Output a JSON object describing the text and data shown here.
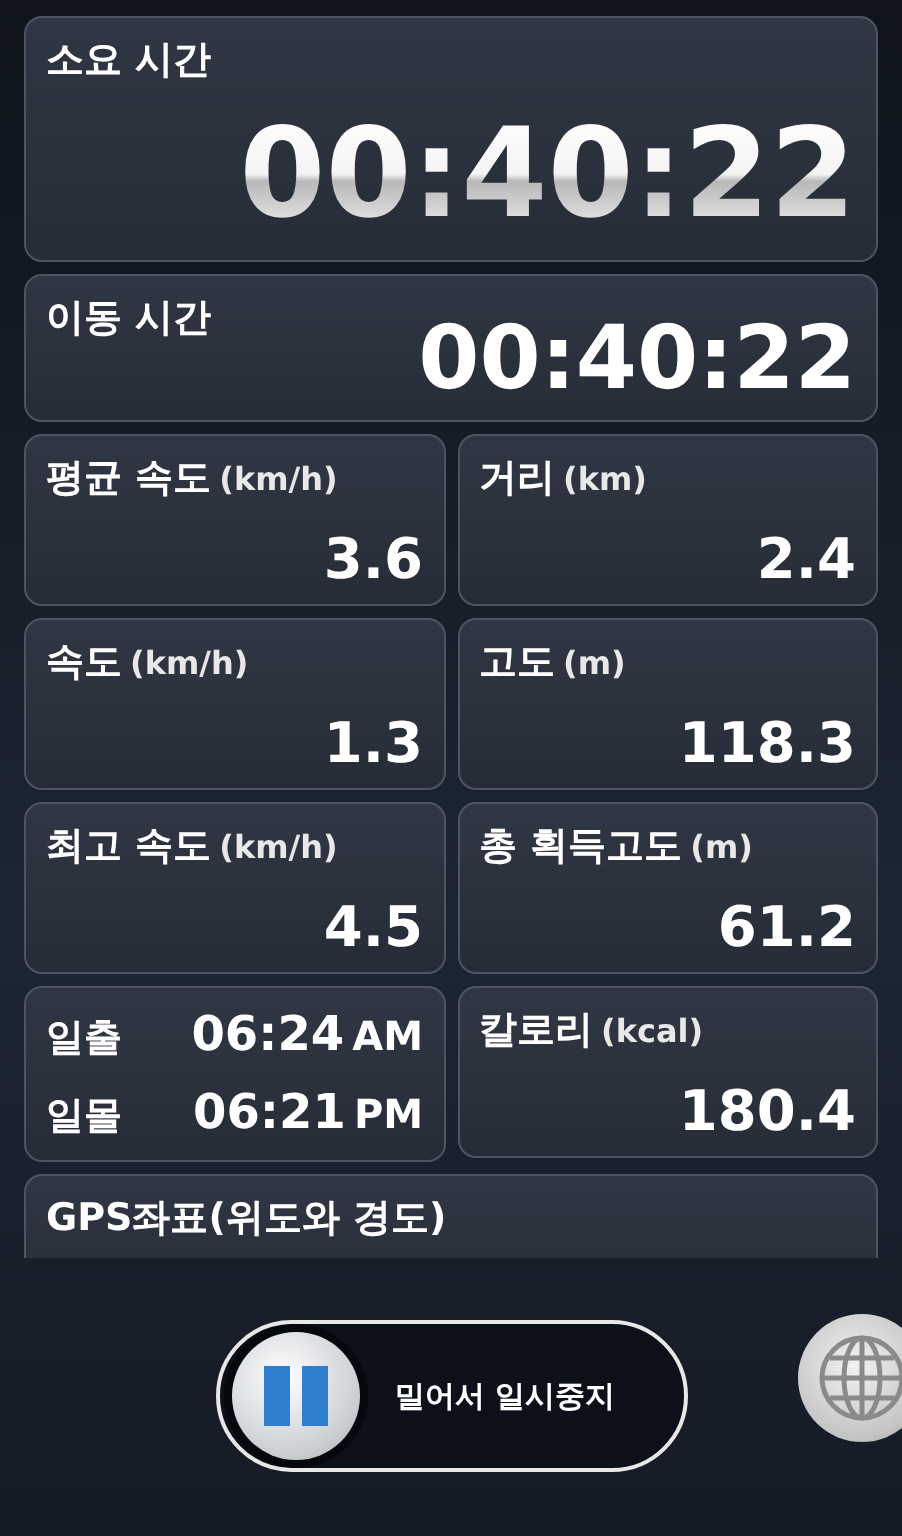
{
  "total_time": {
    "label": "소요 시간",
    "value": "00:40:22"
  },
  "moving_time": {
    "label": "이동 시간",
    "value": "00:40:22"
  },
  "tiles": [
    {
      "kind": "stat",
      "label": "평균 속도",
      "unit": "(km/h)",
      "value": "3.6"
    },
    {
      "kind": "stat",
      "label": "거리",
      "unit": "(km)",
      "value": "2.4"
    },
    {
      "kind": "stat",
      "label": "속도",
      "unit": "(km/h)",
      "value": "1.3"
    },
    {
      "kind": "stat",
      "label": "고도",
      "unit": "(m)",
      "value": "118.3"
    },
    {
      "kind": "stat",
      "label": "최고 속도",
      "unit": "(km/h)",
      "value": "4.5"
    },
    {
      "kind": "stat",
      "label": "총 획득고도",
      "unit": "(m)",
      "value": "61.2"
    },
    {
      "kind": "sun",
      "rows": [
        {
          "label": "일출",
          "time": "06:24",
          "period": "AM"
        },
        {
          "label": "일몰",
          "time": "06:21",
          "period": "PM"
        }
      ]
    },
    {
      "kind": "stat",
      "label": "칼로리",
      "unit": "(kcal)",
      "value": "180.4"
    }
  ],
  "gps": {
    "label": "GPS좌표(위도와 경도)"
  },
  "pause_slider": {
    "label": "밀어서 일시중지",
    "level": 0
  }
}
